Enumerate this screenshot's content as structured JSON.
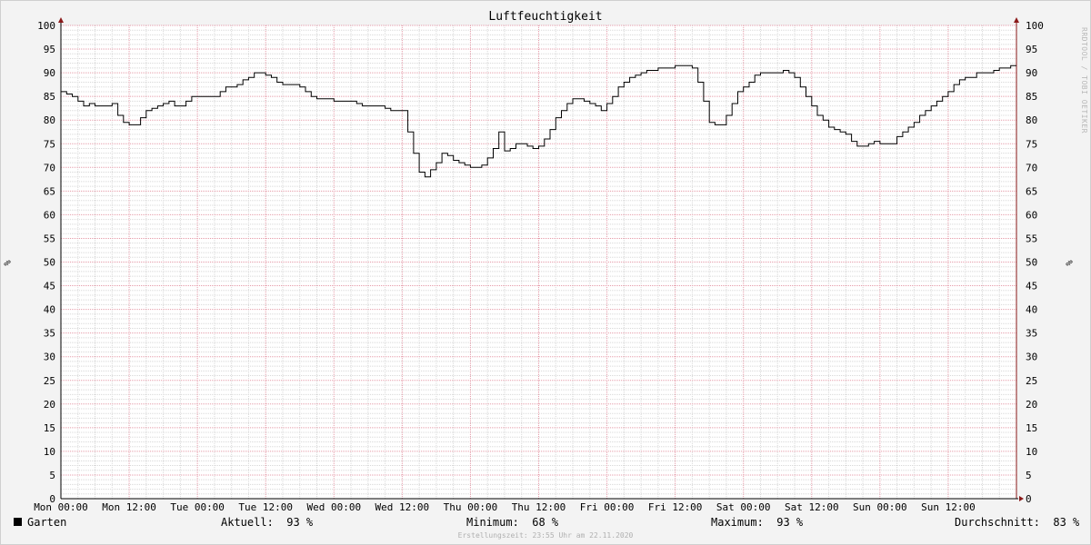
{
  "chart_data": {
    "type": "line",
    "title": "Luftfeuchtigkeit",
    "ylabel": "%",
    "ylim": [
      0,
      100
    ],
    "y_ticks": [
      0,
      5,
      10,
      15,
      20,
      25,
      30,
      35,
      40,
      45,
      50,
      55,
      60,
      65,
      70,
      75,
      80,
      85,
      90,
      95,
      100
    ],
    "x_ticks": [
      "Mon 00:00",
      "Mon 12:00",
      "Tue 00:00",
      "Tue 12:00",
      "Wed 00:00",
      "Wed 12:00",
      "Thu 00:00",
      "Thu 12:00",
      "Fri 00:00",
      "Fri 12:00",
      "Sat 00:00",
      "Sat 12:00",
      "Sun 00:00",
      "Sun 12:00"
    ],
    "x_range_hours": [
      0,
      168
    ],
    "grid": true,
    "series": [
      {
        "name": "Garten",
        "color": "#000000",
        "x_hours": [
          0,
          1,
          2,
          3,
          4,
          5,
          6,
          7,
          8,
          9,
          10,
          11,
          12,
          13,
          14,
          15,
          16,
          17,
          18,
          19,
          20,
          21,
          22,
          23,
          24,
          25,
          26,
          27,
          28,
          29,
          30,
          31,
          32,
          33,
          34,
          35,
          36,
          37,
          38,
          39,
          40,
          41,
          42,
          43,
          44,
          45,
          46,
          47,
          48,
          49,
          50,
          51,
          52,
          53,
          54,
          55,
          56,
          57,
          58,
          59,
          60,
          61,
          62,
          63,
          64,
          65,
          66,
          67,
          68,
          69,
          70,
          71,
          72,
          73,
          74,
          75,
          76,
          77,
          78,
          79,
          80,
          81,
          82,
          83,
          84,
          85,
          86,
          87,
          88,
          89,
          90,
          91,
          92,
          93,
          94,
          95,
          96,
          97,
          98,
          99,
          100,
          101,
          102,
          103,
          104,
          105,
          106,
          107,
          108,
          109,
          110,
          111,
          112,
          113,
          114,
          115,
          116,
          117,
          118,
          119,
          120,
          121,
          122,
          123,
          124,
          125,
          126,
          127,
          128,
          129,
          130,
          131,
          132,
          133,
          134,
          135,
          136,
          137,
          138,
          139,
          140,
          141,
          142,
          143,
          144,
          145,
          146,
          147,
          148,
          149,
          150,
          151,
          152,
          153,
          154,
          155,
          156,
          157,
          158,
          159,
          160,
          161,
          162,
          163,
          164,
          165,
          166,
          167
        ],
        "values": [
          86,
          85.5,
          85,
          84,
          83,
          83.5,
          83,
          83,
          83,
          83.5,
          81,
          79.5,
          79,
          79,
          80.5,
          82,
          82.5,
          83,
          83.5,
          84,
          83,
          83,
          84,
          85,
          85,
          85,
          85,
          85,
          86,
          87,
          87,
          87.5,
          88.5,
          89,
          90,
          90,
          89.5,
          89,
          88,
          87.5,
          87.5,
          87.5,
          87,
          86,
          85,
          84.5,
          84.5,
          84.5,
          84,
          84,
          84,
          84,
          83.5,
          83,
          83,
          83,
          83,
          82.5,
          82,
          82,
          82,
          77.5,
          73,
          69,
          68,
          69.5,
          71,
          73,
          72.5,
          71.5,
          71,
          70.5,
          70,
          70,
          70.5,
          72,
          74,
          77.5,
          73.5,
          74,
          75,
          75,
          74.5,
          74,
          74.5,
          76,
          78,
          80.5,
          82,
          83.5,
          84.5,
          84.5,
          84,
          83.5,
          83,
          82,
          83.5,
          85,
          87,
          88,
          89,
          89.5,
          90,
          90.5,
          90.5,
          91,
          91,
          91,
          91.5,
          91.5,
          91.5,
          91,
          88,
          84,
          79.5,
          79,
          79,
          81,
          83.5,
          86,
          87,
          88,
          89.5,
          90,
          90,
          90,
          90,
          90.5,
          90,
          89,
          87,
          85,
          83,
          81,
          80,
          78.5,
          78,
          77.5,
          77,
          75.5,
          74.5,
          74.5,
          75,
          75.5,
          75,
          75,
          75,
          76.5,
          77.5,
          78.5,
          79.5,
          81,
          82,
          83,
          84,
          85,
          86,
          87.5,
          88.5,
          89,
          89,
          90,
          90,
          90,
          90.5,
          91,
          91,
          91.5,
          92,
          92,
          92,
          92.5,
          93,
          93
        ]
      }
    ]
  },
  "watermark": "RRDTOOL / TOBI OETIKER",
  "legend": {
    "series_name": "Garten",
    "aktuell_label": "Aktuell:",
    "aktuell_value": "93 %",
    "minimum_label": "Minimum:",
    "minimum_value": "68 %",
    "maximum_label": "Maximum:",
    "maximum_value": "93 %",
    "durchschnitt_label": "Durchschnitt:",
    "durchschnitt_value": "83 %"
  },
  "footer": "Erstellungszeit: 23:55 Uhr am 22.11.2020",
  "colors": {
    "major_grid": "#e59aa8",
    "minor_grid": "#d8d8d8",
    "axis": "#000000",
    "arrow": "#8b1a1a"
  }
}
